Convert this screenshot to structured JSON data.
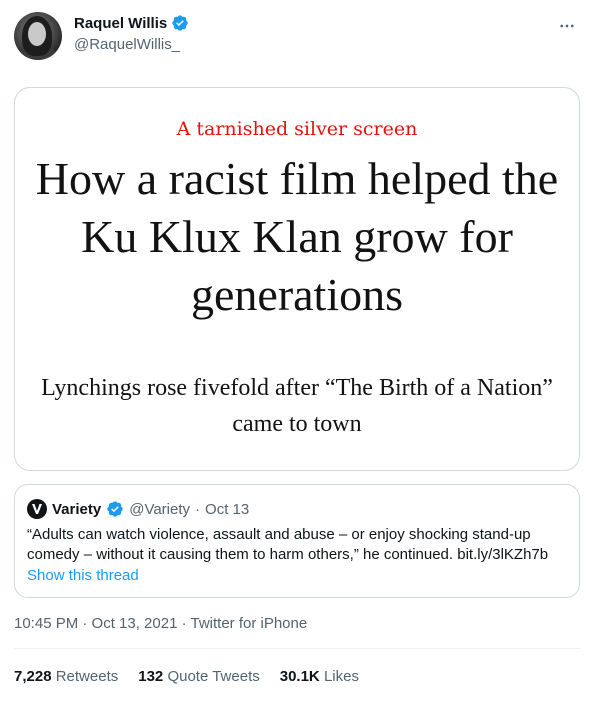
{
  "author": {
    "display_name": "Raquel Willis",
    "handle": "@RaquelWillis_"
  },
  "media": {
    "kicker": "A tarnished silver screen",
    "headline": "How a racist film helped the Ku Klux Klan grow for generations",
    "subhead": "Lynchings rose fivefold after “The Birth of a Nation” came to town"
  },
  "quoted": {
    "name": "Variety",
    "handle": "@Variety",
    "separator": "·",
    "date": "Oct 13",
    "text": "“Adults can watch violence, assault and abuse – or enjoy shocking stand-up comedy – without it causing them to harm others,” he continued. bit.ly/3lKZh7b",
    "show_thread": "Show this thread"
  },
  "timestamp": "10:45 PM · Oct 13, 2021 · Twitter for iPhone",
  "stats": {
    "retweets_count": "7,228",
    "retweets_label": "Retweets",
    "quotes_count": "132",
    "quotes_label": "Quote Tweets",
    "likes_count": "30.1K",
    "likes_label": "Likes"
  },
  "colors": {
    "link_blue": "#1d9bf0",
    "kicker_red": "#e3120b",
    "secondary_text": "#536471"
  },
  "icons": {
    "verified": "verified-badge-icon",
    "more": "more-horizontal-icon",
    "variety_logo": "variety-logo-icon"
  }
}
